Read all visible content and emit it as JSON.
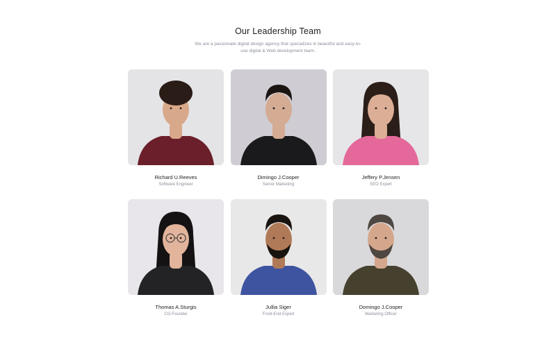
{
  "section": {
    "title": "Our Leadership Team",
    "subtitle": "We are a passionate digital design agency that specializes in beautiful and easy-to-use digital & Web development team."
  },
  "members": [
    {
      "name": "Richard U.Reeves",
      "role": "Software Engineer",
      "icon": "portrait-photo",
      "colors": {
        "bg": "#e4e4e6",
        "shirt": "#6b1f2a",
        "hair": "#2a1c16",
        "skin": "#d8a88a"
      }
    },
    {
      "name": "Dimingo J.Cooper",
      "role": "Senior Marketing",
      "icon": "portrait-photo",
      "colors": {
        "bg": "#cfcdd3",
        "shirt": "#1a1a1c",
        "hair": "#1b1512",
        "skin": "#d4ab93"
      }
    },
    {
      "name": "Jeffery P.Jensen",
      "role": "SEO Expert",
      "icon": "portrait-photo",
      "colors": {
        "bg": "#e6e6e8",
        "shirt": "#e4699a",
        "hair": "#2b1e18",
        "skin": "#dcae95"
      }
    },
    {
      "name": "Thomas A.Sturgis",
      "role": "CO-Founder",
      "icon": "portrait-photo",
      "colors": {
        "bg": "#e8e6ea",
        "shirt": "#232325",
        "hair": "#141213",
        "skin": "#e1b49b"
      }
    },
    {
      "name": "Jullia Siger",
      "role": "Front-End Expert",
      "icon": "portrait-photo",
      "colors": {
        "bg": "#e8e8e8",
        "shirt": "#3f54a0",
        "hair": "#1a1410",
        "skin": "#b07a58"
      }
    },
    {
      "name": "Domingo J.Cooper",
      "role": "Marketing Officer",
      "icon": "portrait-photo",
      "colors": {
        "bg": "#d9d9db",
        "shirt": "#46412f",
        "hair": "#4e4741",
        "skin": "#d4a78d"
      }
    }
  ]
}
